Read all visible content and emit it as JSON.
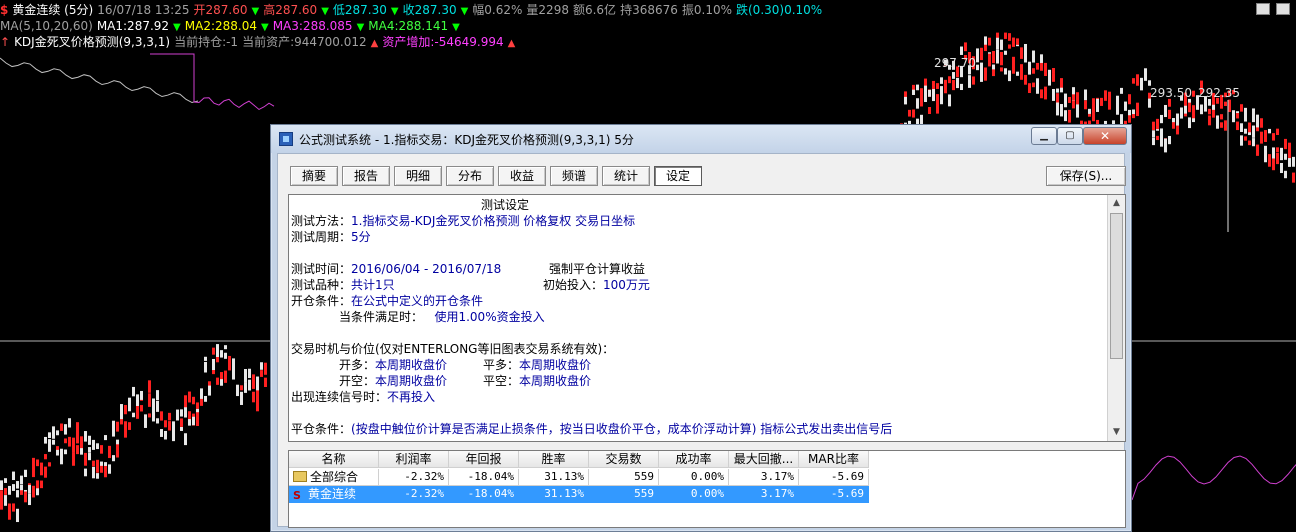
{
  "chart_header": {
    "line1": [
      {
        "text": "$",
        "cls": "dollar"
      },
      {
        "text": "黄金连续 (5分)",
        "cls": "c-white"
      },
      {
        "text": "16/07/18 13:25",
        "cls": "c-grey"
      },
      {
        "text": "开287.60",
        "cls": "c-red"
      },
      {
        "text": "▼",
        "cls": "c-tri"
      },
      {
        "text": "高287.60",
        "cls": "c-red"
      },
      {
        "text": "▼",
        "cls": "c-tri"
      },
      {
        "text": "低287.30",
        "cls": "c-cyan"
      },
      {
        "text": "▼",
        "cls": "c-tri"
      },
      {
        "text": "收287.30",
        "cls": "c-cyan"
      },
      {
        "text": "▼",
        "cls": "c-tri"
      },
      {
        "text": "幅0.62%",
        "cls": "c-grey"
      },
      {
        "text": "量2298",
        "cls": "c-grey"
      },
      {
        "text": "额6.6亿",
        "cls": "c-grey"
      },
      {
        "text": "持368676",
        "cls": "c-grey"
      },
      {
        "text": "振0.10%",
        "cls": "c-grey"
      },
      {
        "text": "跌(0.30)0.10%",
        "cls": "c-cyan"
      }
    ],
    "line2": [
      {
        "text": "MA(5,10,20,60)",
        "cls": "c-grey"
      },
      {
        "text": "MA1:287.92",
        "cls": "c-white"
      },
      {
        "text": "▼",
        "cls": "c-tri"
      },
      {
        "text": "MA2:288.04",
        "cls": "c-yellow"
      },
      {
        "text": "▼",
        "cls": "c-tri"
      },
      {
        "text": "MA3:288.085",
        "cls": "c-magenta"
      },
      {
        "text": "▼",
        "cls": "c-tri"
      },
      {
        "text": "MA4:288.141",
        "cls": "c-green"
      },
      {
        "text": "▼",
        "cls": "c-tri"
      }
    ],
    "line3": [
      {
        "text": "↑",
        "cls": "c-red"
      },
      {
        "text": "KDJ金死叉价格预测(9,3,3,1)",
        "cls": "c-white"
      },
      {
        "text": "当前持仓:-1",
        "cls": "c-grey"
      },
      {
        "text": "当前资产:944700.012",
        "cls": "c-grey"
      },
      {
        "text": "▲",
        "cls": "c-tri-red"
      },
      {
        "text": "资产增加:-54649.994",
        "cls": "c-magenta"
      },
      {
        "text": "▲",
        "cls": "c-tri-red"
      }
    ]
  },
  "price_labels": {
    "p1": "297.70",
    "p2": "293.50",
    "p3": "292.35"
  },
  "colors": {
    "candle_red": "#ff2020",
    "candle_white": "#e8e8e8",
    "ma_magenta": "#d040d0",
    "ma_white": "#c0c0c0"
  },
  "dialog": {
    "title": "公式测试系统 - 1.指标交易：KDJ金死叉价格预测(9,3,3,1) 5分",
    "tabs": [
      "摘要",
      "报告",
      "明细",
      "分布",
      "收益",
      "频谱",
      "统计",
      "设定"
    ],
    "active_tab": 7,
    "save_label": "保存(S)...",
    "report": {
      "heading": "测试设定",
      "method_label": "测试方法：",
      "method_value": "1.指标交易-KDJ金死叉价格预测    价格复权    交易日坐标",
      "period_label": "测试周期：",
      "period_value": "5分",
      "time_label": "测试时间：",
      "time_value": "2016/06/04 - 2016/07/18",
      "force_close": "强制平仓计算收益",
      "variety_label": "测试品种：",
      "variety_value": "共计1只",
      "initial_label": "初始投入：",
      "initial_value": "100万元",
      "open_cond_label": "开仓条件：",
      "open_cond_value": "在公式中定义的开仓条件",
      "when_met_label": "当条件满足时：",
      "when_met_value": "使用1.00%资金投入",
      "timing_label": "交易时机与价位(仅对ENTERLONG等旧图表交易系统有效)：",
      "open_long_label": "开多：",
      "open_long_value": "本周期收盘价",
      "close_long_label": "平多：",
      "close_long_value": "本周期收盘价",
      "open_short_label": "开空：",
      "open_short_value": "本周期收盘价",
      "close_short_label": "平空：",
      "close_short_value": "本周期收盘价",
      "continuous_label": "出现连续信号时：",
      "continuous_value": "不再投入",
      "close_cond_label": "平仓条件：",
      "close_cond_value": "(按盘中触位价计算是否满足止损条件，按当日收盘价平仓，成本价浮动计算)     指标公式发出卖出信号后"
    },
    "grid": {
      "headers": [
        "名称",
        "利润率",
        "年回报",
        "胜率",
        "交易数",
        "成功率",
        "最大回撤...",
        "MAR比率"
      ],
      "rows": [
        {
          "name": "全部综合",
          "icon": "folder-icon",
          "values": [
            "-2.32%",
            "-18.04%",
            "31.13%",
            "559",
            "0.00%",
            "3.17%",
            "-5.69"
          ]
        },
        {
          "name": "黄金连续",
          "icon": "s-icon",
          "values": [
            "-2.32%",
            "-18.04%",
            "31.13%",
            "559",
            "0.00%",
            "3.17%",
            "-5.69"
          ]
        }
      ]
    }
  }
}
